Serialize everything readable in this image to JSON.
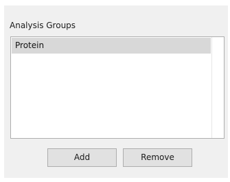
{
  "group": {
    "label": "Analysis Groups"
  },
  "list": {
    "items": [
      {
        "label": "Protein",
        "selected": true
      }
    ]
  },
  "buttons": {
    "add_label": "Add",
    "remove_label": "Remove"
  }
}
